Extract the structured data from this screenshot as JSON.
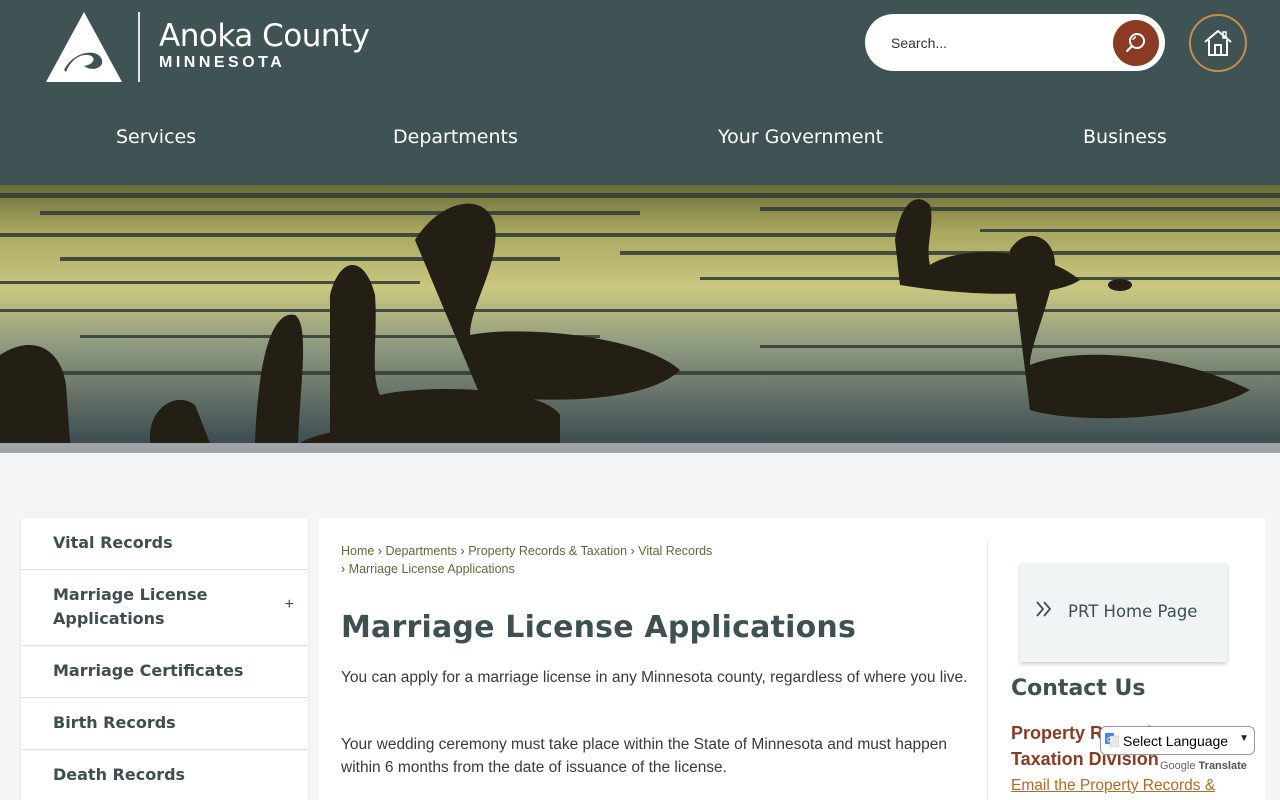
{
  "header": {
    "title": "Anoka County",
    "subtitle": "MINNESOTA",
    "search_placeholder": "Search...",
    "nav": [
      "Services",
      "Departments",
      "Your Government",
      "Business"
    ]
  },
  "sidebar": {
    "items": [
      {
        "label": "Vital Records"
      },
      {
        "label": "Marriage License Applications",
        "expand": "+"
      },
      {
        "label": "Marriage Certificates"
      },
      {
        "label": "Birth Records"
      },
      {
        "label": "Death Records"
      }
    ]
  },
  "breadcrumb": {
    "items": [
      "Home",
      "Departments",
      "Property Records & Taxation",
      "Vital Records",
      "Marriage License Applications"
    ],
    "separator": "›"
  },
  "main": {
    "title": "Marriage License Applications",
    "paragraphs": [
      "You can apply for a marriage license in any Minnesota county, regardless of where you live.",
      "Your wedding ceremony must take place within the State of Minnesota and must happen within 6 months from the date of issuance of the license."
    ]
  },
  "aside": {
    "quick_link": "PRT Home Page",
    "contact_title": "Contact Us",
    "division": "Property Records & Taxation Division",
    "email_link": "Email the Property Records &"
  },
  "translate": {
    "select_label": "Select Language",
    "powered_by": "Google",
    "translate_label": "Translate"
  },
  "colors": {
    "header_bg": "#3f5254",
    "accent_rust": "#8b3a23",
    "accent_gold": "#c88e48",
    "heading": "#3e5052"
  }
}
